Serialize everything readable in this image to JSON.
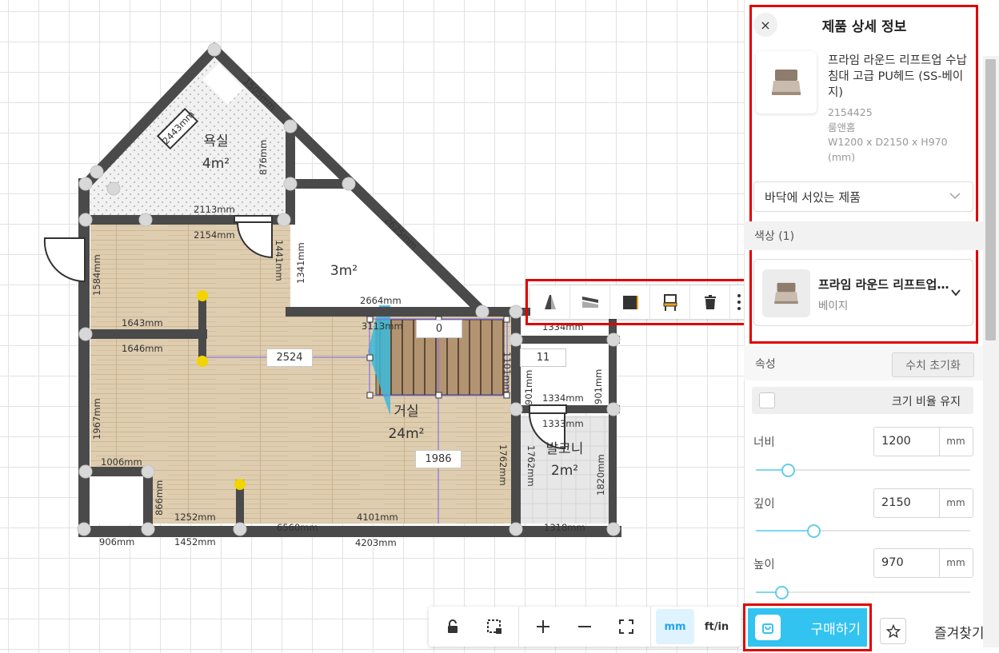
{
  "canvas": {
    "rooms": [
      {
        "name": "욕실",
        "area": "4m²"
      },
      {
        "name": "",
        "area": "3m²"
      },
      {
        "name": "거실",
        "area": "24m²"
      },
      {
        "name": "발코니",
        "area": "2m²"
      }
    ],
    "dimensions": [
      "2443mm",
      "1505mm",
      "876mm",
      "2113mm",
      "2154mm",
      "1441mm",
      "1341mm",
      "2625mm",
      "1584mm",
      "1643mm",
      "1646mm",
      "2664mm",
      "3113mm",
      "1334mm",
      "1101mm",
      "1967mm",
      "901mm",
      "901mm",
      "1334mm",
      "1333mm",
      "1762mm",
      "1762mm",
      "1820mm",
      "1006mm",
      "866mm",
      "1252mm",
      "4101mm",
      "6560mm",
      "1318mm",
      "906mm",
      "1452mm",
      "4203mm"
    ],
    "dim_inputs": {
      "stair_length": "0",
      "room_width": "2524",
      "room_height": "1986",
      "balcony": "11"
    },
    "floating_toolbar": [
      "wall-slope-icon",
      "floor-height-icon",
      "material-icon",
      "chair-replace-icon",
      "trash-icon",
      "more-vertical-icon"
    ]
  },
  "bottom_toolbar": {
    "unit_mm": "mm",
    "unit_ftin": "ft/in"
  },
  "panel": {
    "title": "제품 상세 정보",
    "close_icon": "×",
    "product": {
      "name": "프라임 라운드 리프트업 수납침대 고급 PU헤드 (SS-베이지)",
      "code": "2154425",
      "brand": "룸앤홈",
      "size": "W1200 x D2150 x H970 (mm)"
    },
    "placement": "바닥에 서있는 제품",
    "color_section": "색상 (1)",
    "color_option": {
      "name": "프라임 라운드 리프트업 수납침대",
      "sub": "베이지"
    },
    "attributes": {
      "label": "속성",
      "reset": "수치 초기화",
      "keep_ratio": "크기 비율 유지",
      "width": {
        "label": "너비",
        "value": "1200",
        "unit": "mm",
        "level": 0.15
      },
      "depth": {
        "label": "깊이",
        "value": "2150",
        "unit": "mm",
        "level": 0.27
      },
      "height": {
        "label": "높이",
        "value": "970",
        "unit": "mm",
        "level": 0.12
      }
    },
    "buy": "구매하기",
    "favorite": "즐겨찾기"
  },
  "colors": {
    "accent": "#33c3f0",
    "highlight": "#e00000",
    "wall": "#4a4a4a",
    "floor_wood": "#dcc8a8"
  }
}
